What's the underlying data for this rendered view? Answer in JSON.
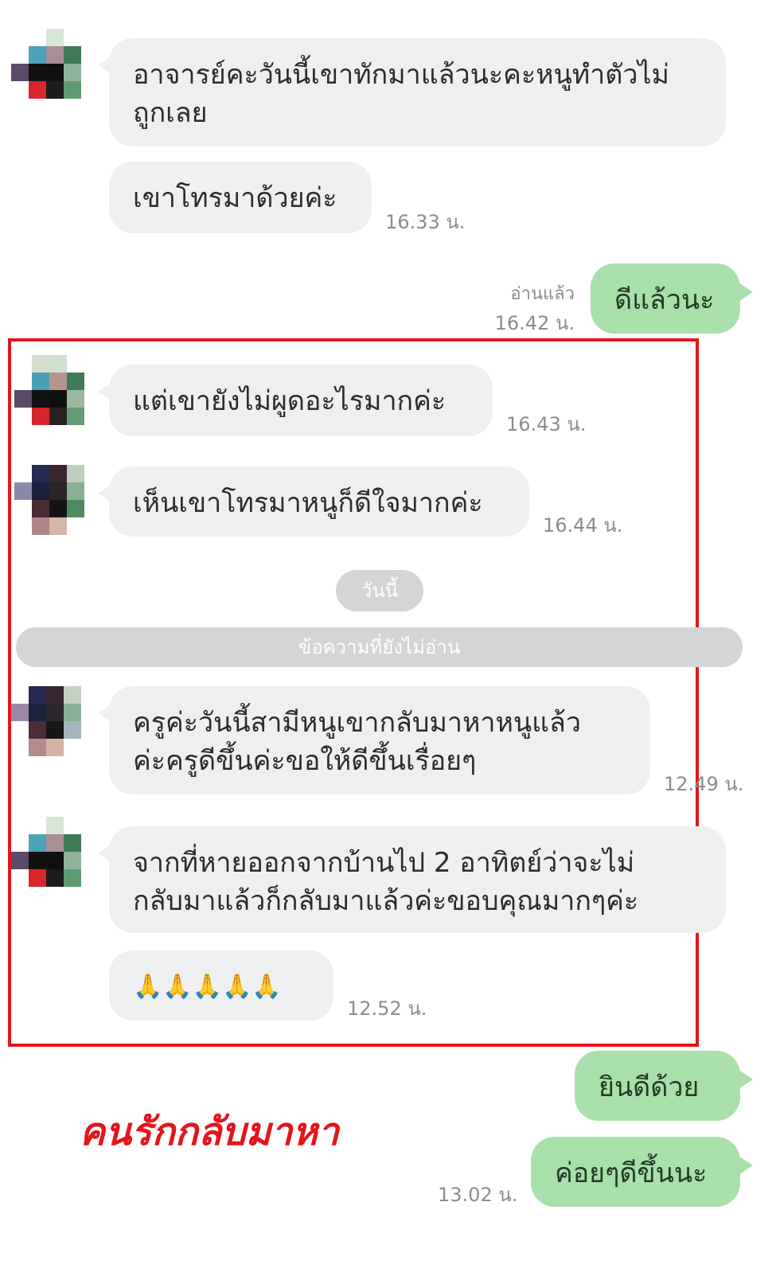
{
  "messages": [
    {
      "lines": [
        "อาจารย์คะวันนี้เขาทักมาแล้วนะคะหนูทำตัวไม่",
        "ถูกเลย"
      ]
    },
    {
      "text": "เขาโทรมาด้วยค่ะ",
      "time": "16.33 น."
    },
    {
      "text": "ดีแล้วนะ",
      "status": "อ่านแล้ว",
      "time": "16.42 น."
    },
    {
      "text": "แต่เขายังไม่ผูดอะไรมากค่ะ",
      "time": "16.43 น."
    },
    {
      "text": "เห็นเขาโทรมาหนูก็ดีใจมากค่ะ",
      "time": "16.44 น."
    },
    {
      "lines": [
        "ครูค่ะวันนี้สามีหนูเขากลับมาหาหนูแล้ว",
        "ค่ะครูดีขึ้นค่ะขอให้ดีขึ้นเรื่อยๆ"
      ],
      "time": "12.49 น."
    },
    {
      "lines": [
        "จากที่หายออกจากบ้านไป 2 อาทิตย์ว่าจะไม่",
        "กลับมาแล้วก็กลับมาแล้วค่ะขอบคุณมากๆค่ะ"
      ]
    },
    {
      "text": "🙏🙏🙏🙏🙏",
      "time": "12.52 น."
    },
    {
      "text": "ยินดีด้วย"
    },
    {
      "text": "ค่อยๆดีขึ้นนะ",
      "time": "13.02 น."
    }
  ],
  "date_label": "วันนี้",
  "unread_label": "ข้อความที่ยังไม่อ่าน",
  "caption": "คนรักกลับมาหา",
  "colors": {
    "incoming_bubble": "#eeeff0",
    "outgoing_bubble": "#a9dfaa",
    "highlight_border": "#e3151b",
    "caption": "#e3151b",
    "timestamp": "#8c8c8c"
  }
}
